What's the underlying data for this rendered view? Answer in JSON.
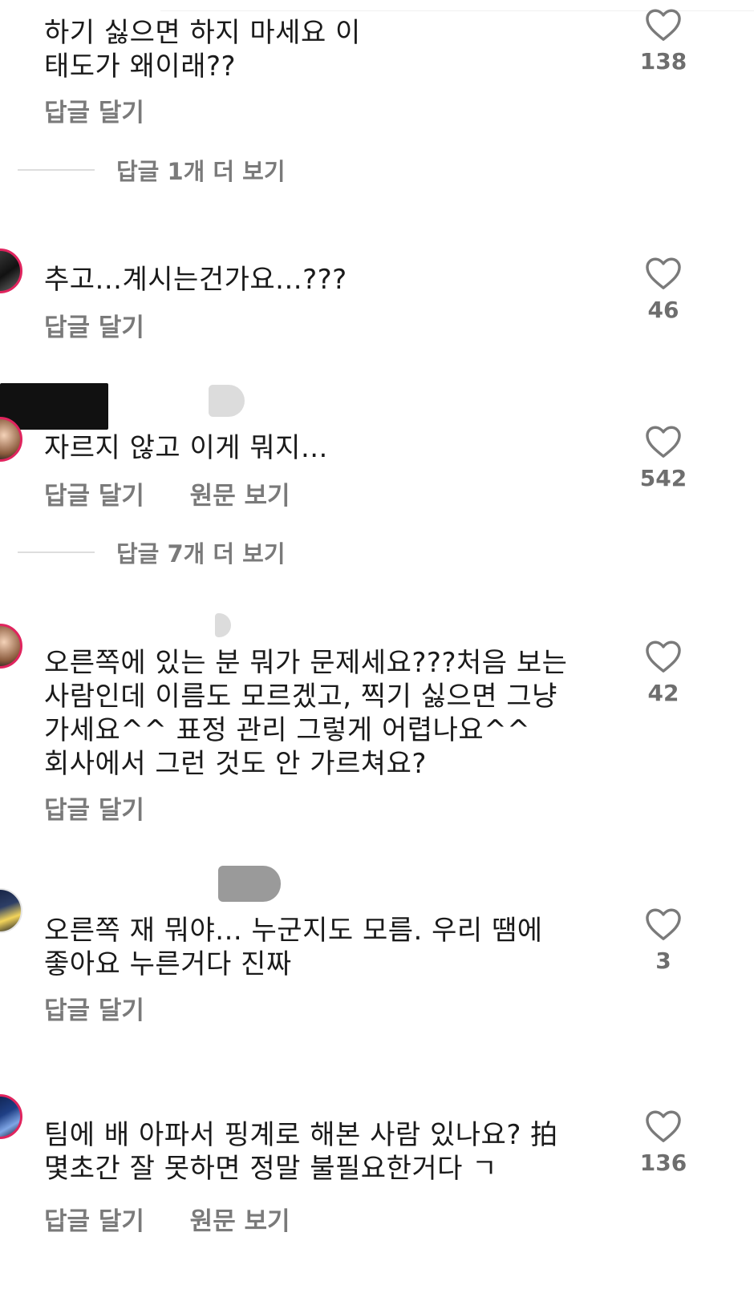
{
  "colors": {
    "text": "#1a1a1a",
    "secondary": "#7a7a7a",
    "avatar_ring": "#e0245e",
    "heart_outline": "#7a7a7a"
  },
  "icons": {
    "like": "heart-outline-icon"
  },
  "comments": [
    {
      "text": "하기 싫으면 하지 마세요 이\n태도가 왜이래??",
      "like_count": "138",
      "reply_label": "답글 달기"
    },
    {
      "text": "추고...계시는건가요...???",
      "like_count": "46",
      "reply_label": "답글 달기"
    },
    {
      "text": "자르지 않고 이게 뭐지...",
      "like_count": "542",
      "reply_label": "답글 달기",
      "original_label": "원문 보기"
    },
    {
      "text": "오른쪽에 있는 분 뭐가 문제세요???처음 보는\n사람인데 이름도 모르겠고, 찍기 싫으면 그냥\n가세요^^ 표정 관리 그렇게 어렵나요^^\n회사에서 그런 것도 안 가르쳐요?",
      "like_count": "42",
      "reply_label": "답글 달기"
    },
    {
      "text": "오른쪽 재 뭐야... 누군지도 모름. 우리       땜에\n좋아요 누른거다 진짜",
      "like_count": "3",
      "reply_label": "답글 달기"
    },
    {
      "text": "팀에 배 아파서 핑계로 해본 사람 있나요? 拍\n몇초간 잘 못하면 정말 불필요한거다 ㄱ",
      "like_count": "136",
      "reply_label": "답글 달기",
      "original_label": "원문 보기"
    }
  ],
  "more_replies": [
    {
      "label": "답글 1개 더 보기"
    },
    {
      "label": "답글 7개 더 보기"
    }
  ]
}
